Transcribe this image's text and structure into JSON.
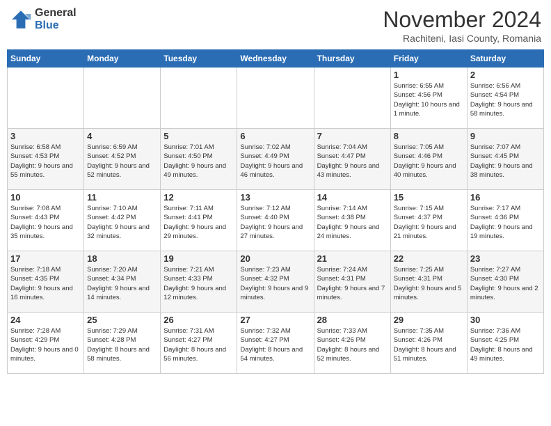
{
  "header": {
    "logo_general": "General",
    "logo_blue": "Blue",
    "main_title": "November 2024",
    "subtitle": "Rachiteni, Iasi County, Romania"
  },
  "days_of_week": [
    "Sunday",
    "Monday",
    "Tuesday",
    "Wednesday",
    "Thursday",
    "Friday",
    "Saturday"
  ],
  "weeks": [
    [
      {
        "day": "",
        "info": ""
      },
      {
        "day": "",
        "info": ""
      },
      {
        "day": "",
        "info": ""
      },
      {
        "day": "",
        "info": ""
      },
      {
        "day": "",
        "info": ""
      },
      {
        "day": "1",
        "info": "Sunrise: 6:55 AM\nSunset: 4:56 PM\nDaylight: 10 hours\nand 1 minute."
      },
      {
        "day": "2",
        "info": "Sunrise: 6:56 AM\nSunset: 4:54 PM\nDaylight: 9 hours\nand 58 minutes."
      }
    ],
    [
      {
        "day": "3",
        "info": "Sunrise: 6:58 AM\nSunset: 4:53 PM\nDaylight: 9 hours\nand 55 minutes."
      },
      {
        "day": "4",
        "info": "Sunrise: 6:59 AM\nSunset: 4:52 PM\nDaylight: 9 hours\nand 52 minutes."
      },
      {
        "day": "5",
        "info": "Sunrise: 7:01 AM\nSunset: 4:50 PM\nDaylight: 9 hours\nand 49 minutes."
      },
      {
        "day": "6",
        "info": "Sunrise: 7:02 AM\nSunset: 4:49 PM\nDaylight: 9 hours\nand 46 minutes."
      },
      {
        "day": "7",
        "info": "Sunrise: 7:04 AM\nSunset: 4:47 PM\nDaylight: 9 hours\nand 43 minutes."
      },
      {
        "day": "8",
        "info": "Sunrise: 7:05 AM\nSunset: 4:46 PM\nDaylight: 9 hours\nand 40 minutes."
      },
      {
        "day": "9",
        "info": "Sunrise: 7:07 AM\nSunset: 4:45 PM\nDaylight: 9 hours\nand 38 minutes."
      }
    ],
    [
      {
        "day": "10",
        "info": "Sunrise: 7:08 AM\nSunset: 4:43 PM\nDaylight: 9 hours\nand 35 minutes."
      },
      {
        "day": "11",
        "info": "Sunrise: 7:10 AM\nSunset: 4:42 PM\nDaylight: 9 hours\nand 32 minutes."
      },
      {
        "day": "12",
        "info": "Sunrise: 7:11 AM\nSunset: 4:41 PM\nDaylight: 9 hours\nand 29 minutes."
      },
      {
        "day": "13",
        "info": "Sunrise: 7:12 AM\nSunset: 4:40 PM\nDaylight: 9 hours\nand 27 minutes."
      },
      {
        "day": "14",
        "info": "Sunrise: 7:14 AM\nSunset: 4:38 PM\nDaylight: 9 hours\nand 24 minutes."
      },
      {
        "day": "15",
        "info": "Sunrise: 7:15 AM\nSunset: 4:37 PM\nDaylight: 9 hours\nand 21 minutes."
      },
      {
        "day": "16",
        "info": "Sunrise: 7:17 AM\nSunset: 4:36 PM\nDaylight: 9 hours\nand 19 minutes."
      }
    ],
    [
      {
        "day": "17",
        "info": "Sunrise: 7:18 AM\nSunset: 4:35 PM\nDaylight: 9 hours\nand 16 minutes."
      },
      {
        "day": "18",
        "info": "Sunrise: 7:20 AM\nSunset: 4:34 PM\nDaylight: 9 hours\nand 14 minutes."
      },
      {
        "day": "19",
        "info": "Sunrise: 7:21 AM\nSunset: 4:33 PM\nDaylight: 9 hours\nand 12 minutes."
      },
      {
        "day": "20",
        "info": "Sunrise: 7:23 AM\nSunset: 4:32 PM\nDaylight: 9 hours\nand 9 minutes."
      },
      {
        "day": "21",
        "info": "Sunrise: 7:24 AM\nSunset: 4:31 PM\nDaylight: 9 hours\nand 7 minutes."
      },
      {
        "day": "22",
        "info": "Sunrise: 7:25 AM\nSunset: 4:31 PM\nDaylight: 9 hours\nand 5 minutes."
      },
      {
        "day": "23",
        "info": "Sunrise: 7:27 AM\nSunset: 4:30 PM\nDaylight: 9 hours\nand 2 minutes."
      }
    ],
    [
      {
        "day": "24",
        "info": "Sunrise: 7:28 AM\nSunset: 4:29 PM\nDaylight: 9 hours\nand 0 minutes."
      },
      {
        "day": "25",
        "info": "Sunrise: 7:29 AM\nSunset: 4:28 PM\nDaylight: 8 hours\nand 58 minutes."
      },
      {
        "day": "26",
        "info": "Sunrise: 7:31 AM\nSunset: 4:27 PM\nDaylight: 8 hours\nand 56 minutes."
      },
      {
        "day": "27",
        "info": "Sunrise: 7:32 AM\nSunset: 4:27 PM\nDaylight: 8 hours\nand 54 minutes."
      },
      {
        "day": "28",
        "info": "Sunrise: 7:33 AM\nSunset: 4:26 PM\nDaylight: 8 hours\nand 52 minutes."
      },
      {
        "day": "29",
        "info": "Sunrise: 7:35 AM\nSunset: 4:26 PM\nDaylight: 8 hours\nand 51 minutes."
      },
      {
        "day": "30",
        "info": "Sunrise: 7:36 AM\nSunset: 4:25 PM\nDaylight: 8 hours\nand 49 minutes."
      }
    ]
  ]
}
